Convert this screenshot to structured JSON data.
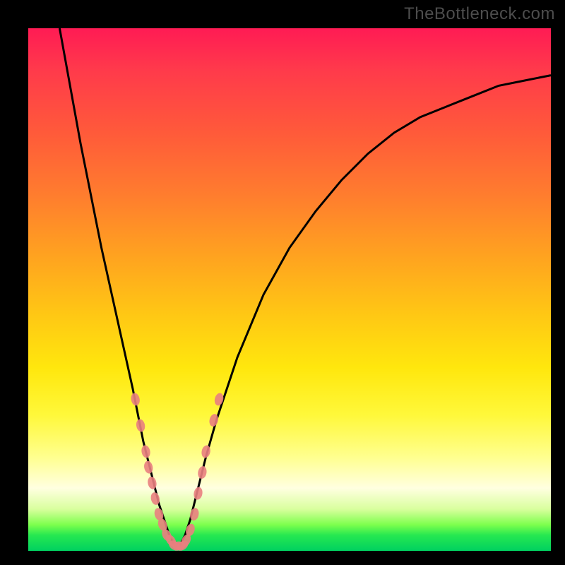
{
  "watermark": "TheBottleneck.com",
  "colors": {
    "gradient_top": "#ff1b54",
    "gradient_mid": "#ffe70d",
    "gradient_bottom": "#00d060",
    "curve": "#000000",
    "dot": "#e98080",
    "frame": "#000000"
  },
  "chart_data": {
    "type": "line",
    "title": "",
    "xlabel": "",
    "ylabel": "",
    "xlim": [
      0,
      100
    ],
    "ylim": [
      0,
      100
    ],
    "grid": false,
    "legend": false,
    "series": [
      {
        "name": "left-curve",
        "x": [
          6,
          8,
          10,
          12,
          14,
          16,
          18,
          20,
          21,
          22,
          23,
          24,
          25,
          26,
          27,
          28
        ],
        "y": [
          100,
          89,
          78,
          68,
          58,
          49,
          40,
          31,
          26,
          21,
          17,
          13,
          9,
          6,
          3,
          1
        ]
      },
      {
        "name": "right-curve",
        "x": [
          29,
          30,
          31,
          32,
          34,
          36,
          40,
          45,
          50,
          55,
          60,
          65,
          70,
          75,
          80,
          85,
          90,
          95,
          100
        ],
        "y": [
          1,
          3,
          6,
          10,
          18,
          25,
          37,
          49,
          58,
          65,
          71,
          76,
          80,
          83,
          85,
          87,
          89,
          90,
          91
        ]
      }
    ],
    "annotations": [
      {
        "name": "highlight-dots",
        "points": [
          {
            "x": 20.5,
            "y": 29
          },
          {
            "x": 21.5,
            "y": 24
          },
          {
            "x": 22.5,
            "y": 19
          },
          {
            "x": 23.0,
            "y": 16
          },
          {
            "x": 23.7,
            "y": 13
          },
          {
            "x": 24.3,
            "y": 10
          },
          {
            "x": 25.0,
            "y": 7
          },
          {
            "x": 25.7,
            "y": 5
          },
          {
            "x": 26.5,
            "y": 3
          },
          {
            "x": 27.3,
            "y": 2
          },
          {
            "x": 28.0,
            "y": 1
          },
          {
            "x": 28.8,
            "y": 1
          },
          {
            "x": 29.5,
            "y": 1
          },
          {
            "x": 30.2,
            "y": 2
          },
          {
            "x": 31.0,
            "y": 4
          },
          {
            "x": 31.8,
            "y": 7
          },
          {
            "x": 32.5,
            "y": 11
          },
          {
            "x": 33.3,
            "y": 15
          },
          {
            "x": 34.0,
            "y": 19
          },
          {
            "x": 35.5,
            "y": 25
          },
          {
            "x": 36.5,
            "y": 29
          }
        ]
      }
    ]
  }
}
